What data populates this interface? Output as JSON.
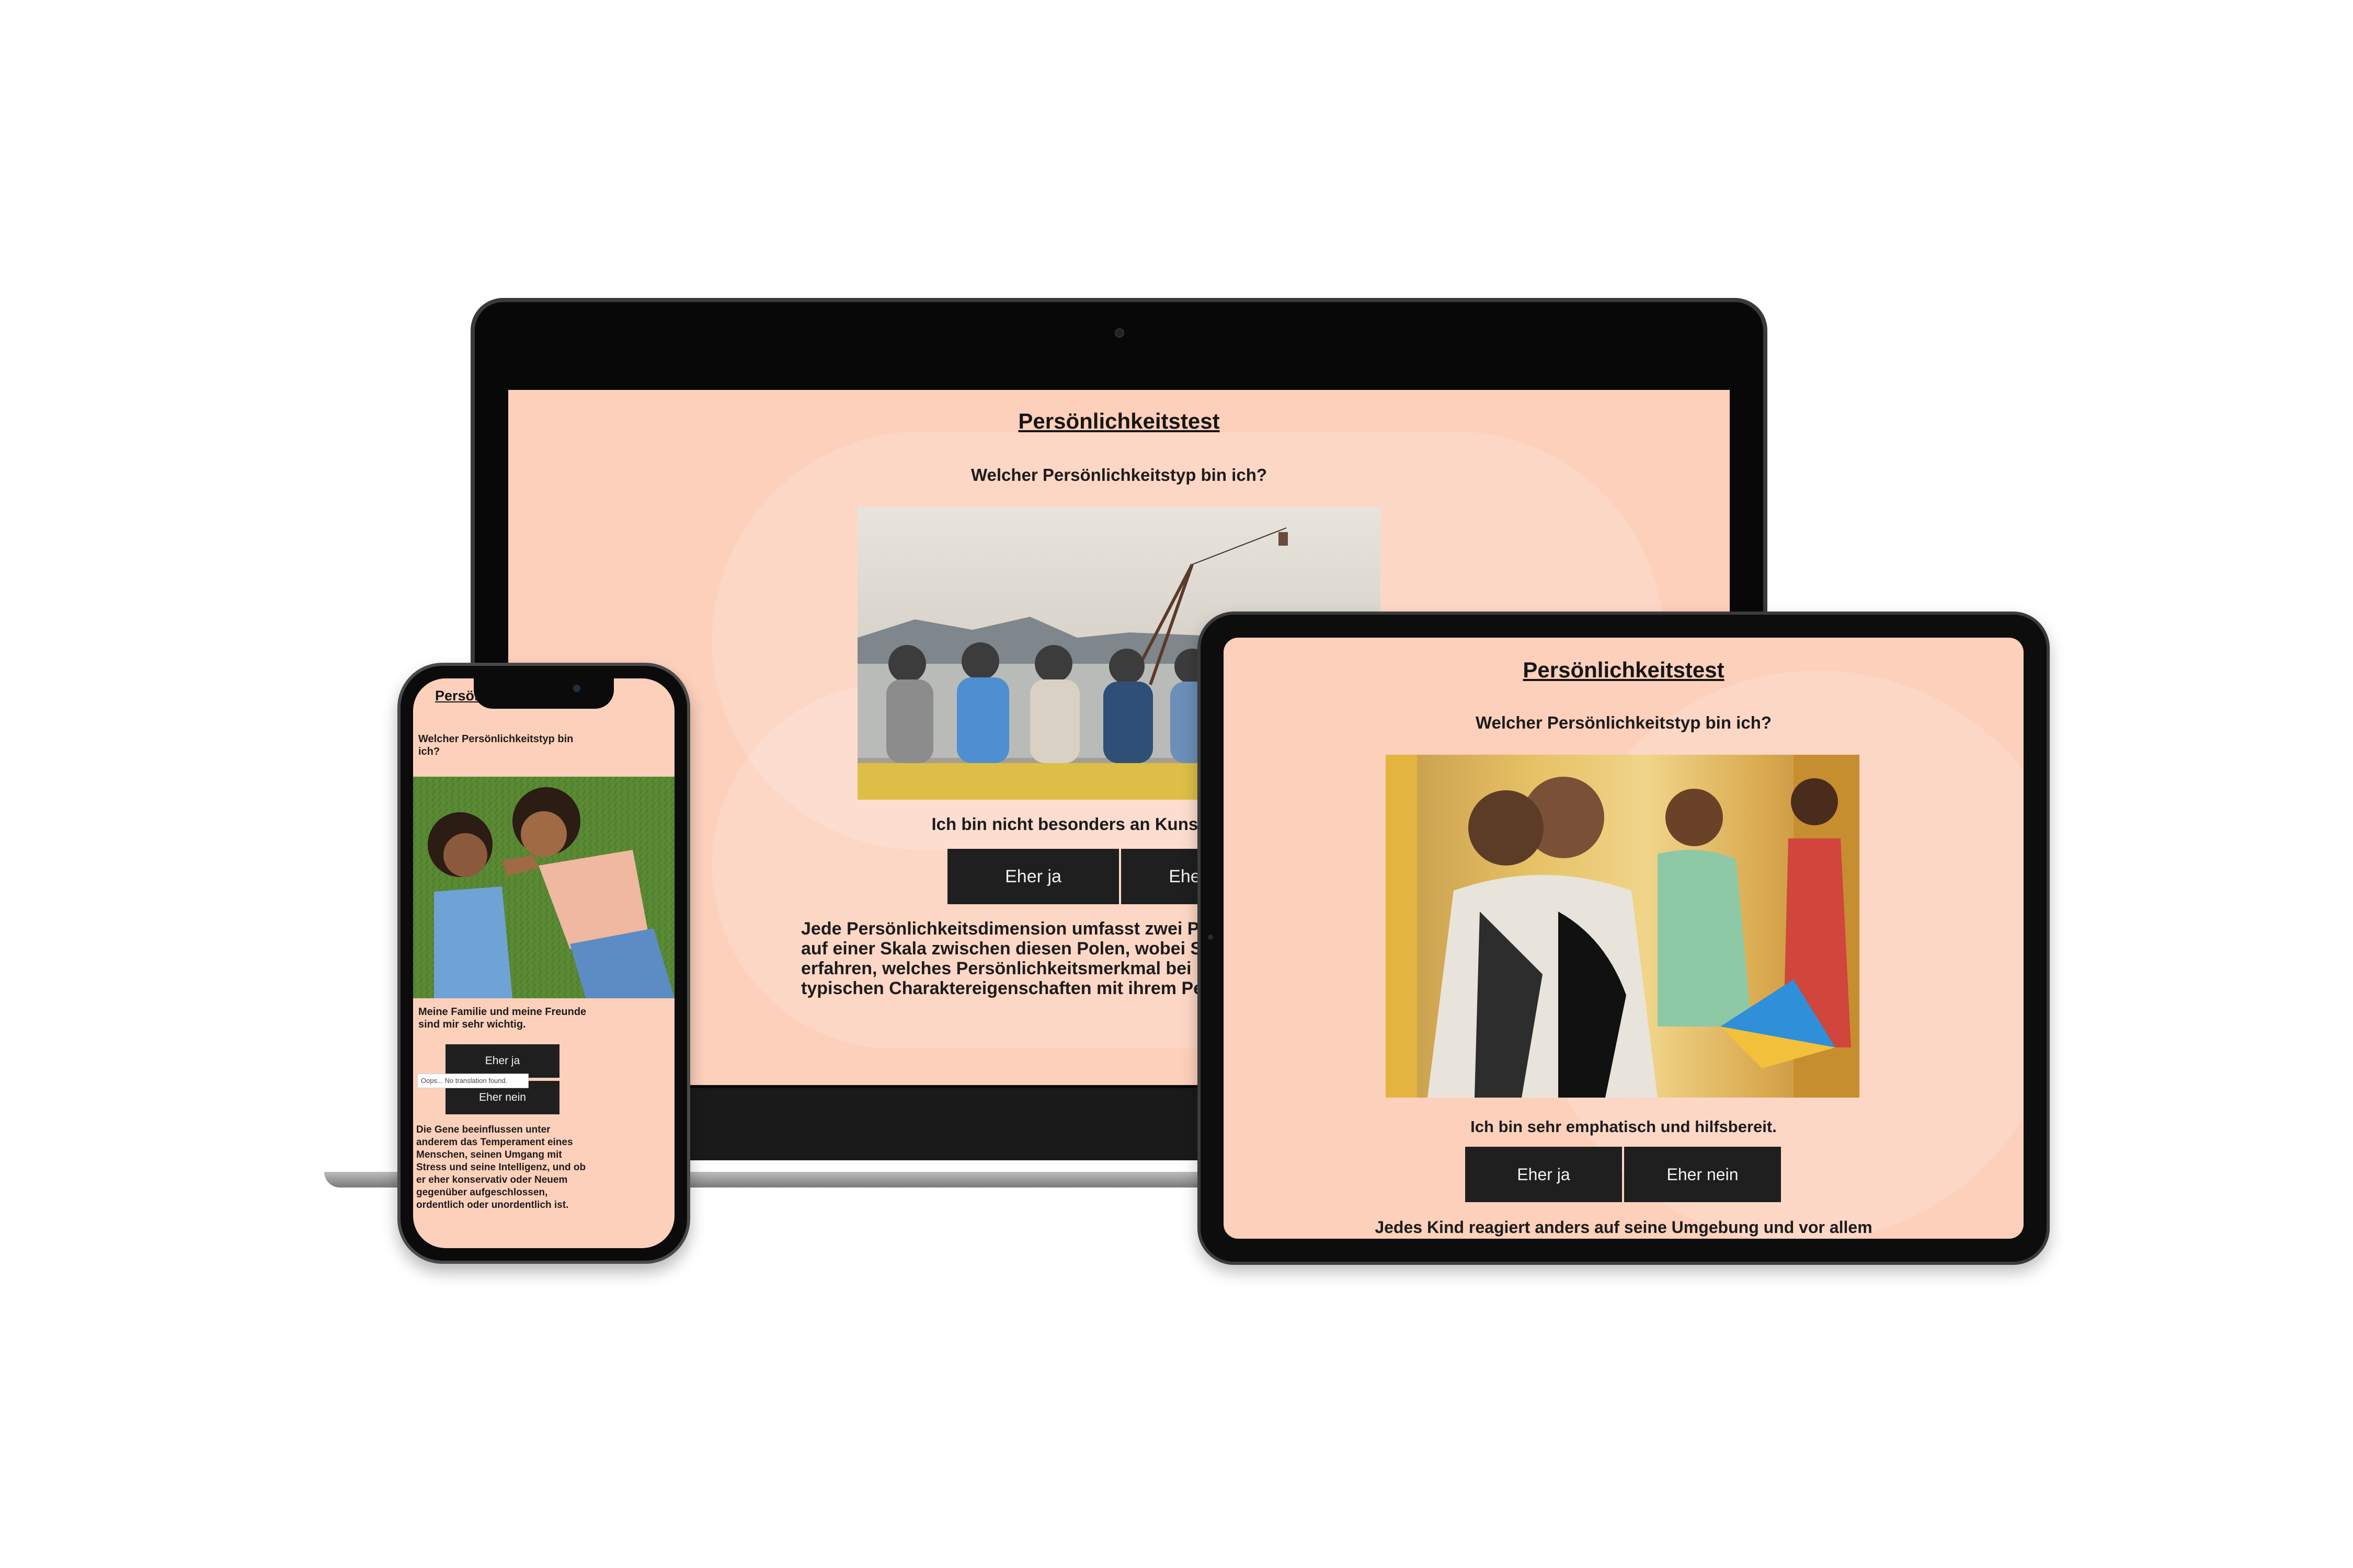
{
  "laptop": {
    "title": "Persönlichkeitstest",
    "subtitle": "Welcher Persönlichkeitstyp bin ich?",
    "statement": "Ich bin nicht besonders an Kunst interessiert.",
    "yes_label": "Eher ja",
    "no_label": "Eher nein",
    "body_p1": "Jede Persönlichkeitsdimension umfasst zwei Pole. Hier können Sie sich",
    "body_p2": "auf einer Skala zwischen diesen Polen, wobei Sie",
    "body_p3": "erfahren, welches Persönlichkeitsmerkmal bei Ihnen",
    "body_p4": "typischen Charaktereigenschaften mit ihrem Persönlichkeitstyp"
  },
  "tablet": {
    "title": "Persönlichkeitstest",
    "subtitle": "Welcher Persönlichkeitstyp bin ich?",
    "statement": "Ich bin sehr emphatisch und hilfsbereit.",
    "yes_label": "Eher ja",
    "no_label": "Eher nein",
    "body_first_line": "Jedes Kind reagiert anders auf seine Umgebung und vor allem"
  },
  "phone": {
    "title": "Persönlichkeitstest",
    "subtitle": "Welcher Persönlichkeitstyp bin ich?",
    "statement": "Meine Familie und meine Freunde sind mir sehr wichtig.",
    "yes_label": "Eher ja",
    "no_label": "Eher nein",
    "tooltip": "Oops... No translation found.",
    "body": "Die Gene beeinflussen unter anderem das Temperament eines Menschen, seinen Umgang mit Stress und seine Intelligenz, und ob er eher konservativ oder Neuem gegenüber aufgeschlossen, ordentlich oder unordentlich ist."
  },
  "colors": {
    "screen_bg": "#fdd0bb",
    "button_bg": "#1f1f1f",
    "button_text": "#f2f2f2",
    "device_frame": "#0d0d0d"
  }
}
